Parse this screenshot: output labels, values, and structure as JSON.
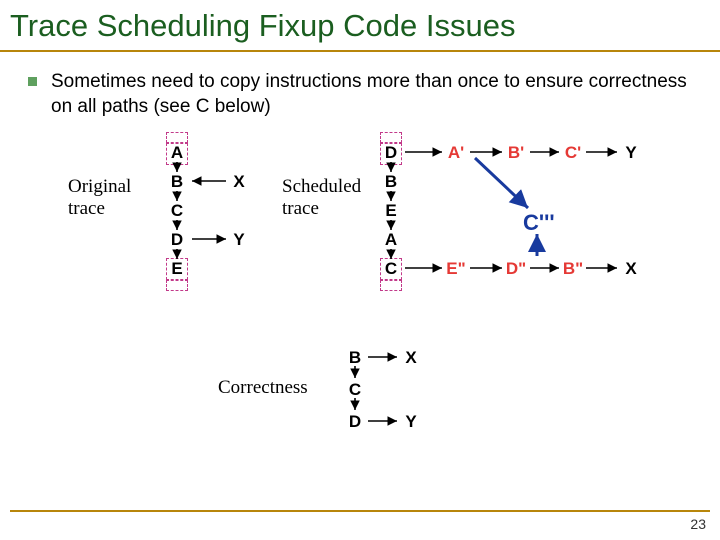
{
  "title": "Trace Scheduling Fixup Code Issues",
  "bullet": "Sometimes need to copy instructions more than once to ensure correctness on all paths (see C below)",
  "labels": {
    "original": "Original\ntrace",
    "scheduled": "Scheduled\ntrace",
    "correctness": "Correctness"
  },
  "orig": {
    "A": "A",
    "B": "B",
    "C": "C",
    "D": "D",
    "E": "E",
    "X": "X",
    "Y": "Y"
  },
  "sched": {
    "D": "D",
    "B": "B",
    "E": "E",
    "A": "A",
    "C": "C",
    "Ap": "A'",
    "Bp": "B'",
    "Cp": "C'",
    "Y": "Y",
    "Edd": "E\"",
    "Ddd": "D\"",
    "Bdd": "B\"",
    "X": "X",
    "Cppp": "C'''"
  },
  "corr": {
    "B": "B",
    "C": "C",
    "D": "D",
    "X": "X",
    "Y": "Y"
  },
  "page": "23"
}
